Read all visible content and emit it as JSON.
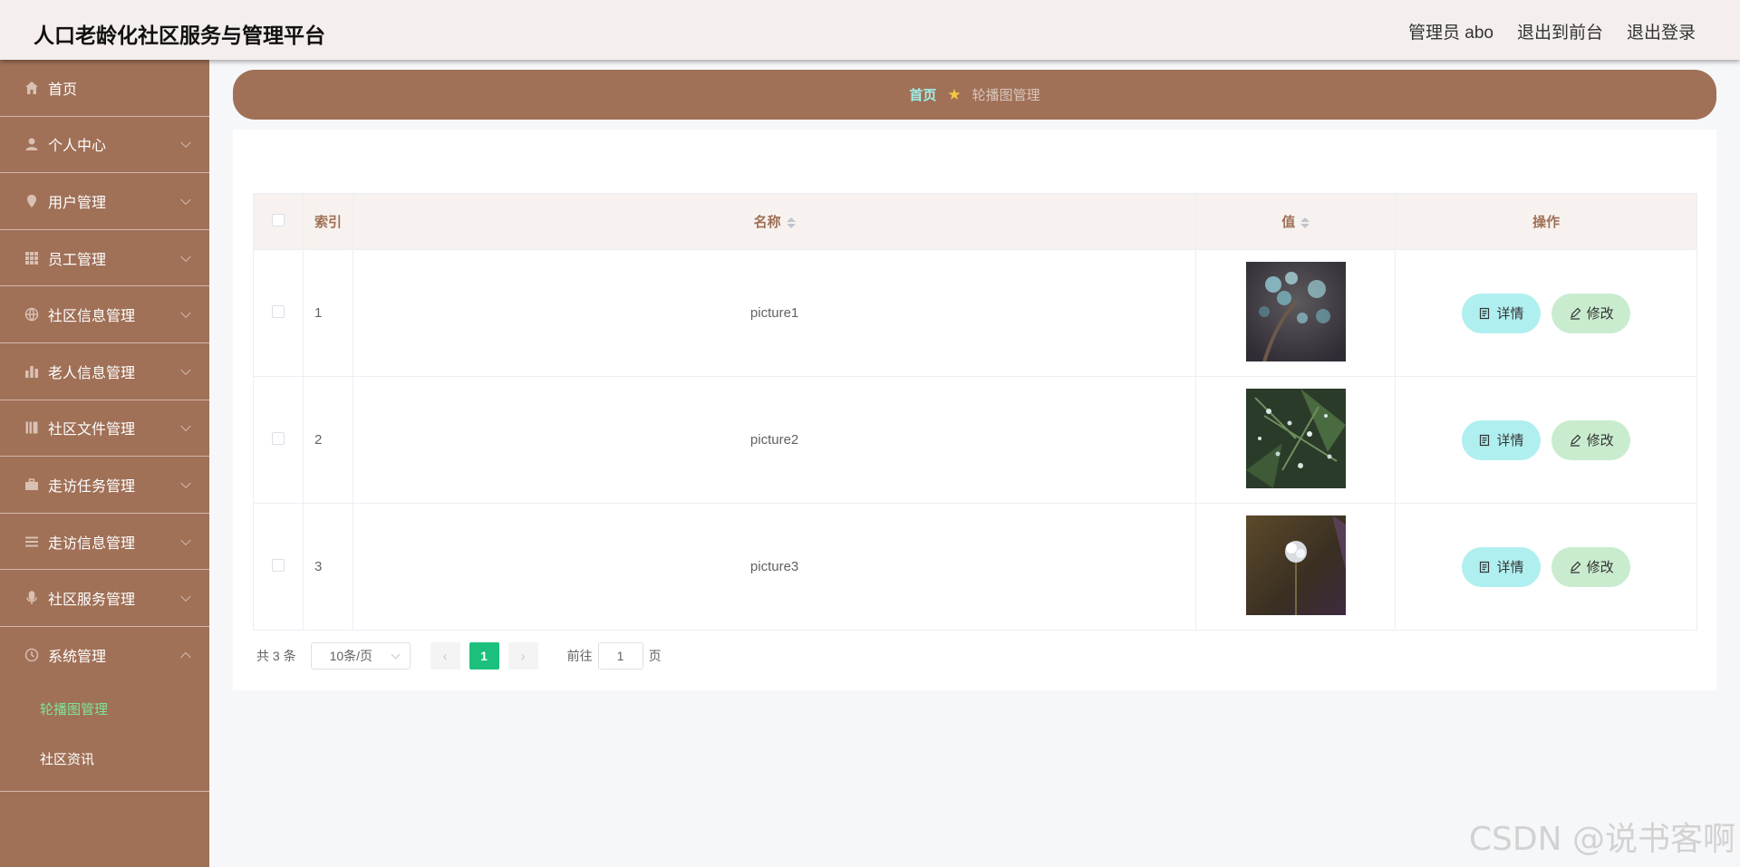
{
  "header": {
    "title": "人口老龄化社区服务与管理平台",
    "admin_label": "管理员 abo",
    "front_label": "退出到前台",
    "logout_label": "退出登录"
  },
  "sidebar": {
    "items": [
      {
        "label": "首页",
        "icon": "home-icon",
        "has_arrow": false
      },
      {
        "label": "个人中心",
        "icon": "user-icon",
        "has_arrow": true
      },
      {
        "label": "用户管理",
        "icon": "location-icon",
        "has_arrow": true
      },
      {
        "label": "员工管理",
        "icon": "grid-icon",
        "has_arrow": true
      },
      {
        "label": "社区信息管理",
        "icon": "globe-icon",
        "has_arrow": true
      },
      {
        "label": "老人信息管理",
        "icon": "bar-chart-icon",
        "has_arrow": true
      },
      {
        "label": "社区文件管理",
        "icon": "folder-icon",
        "has_arrow": true
      },
      {
        "label": "走访任务管理",
        "icon": "briefcase-icon",
        "has_arrow": true
      },
      {
        "label": "走访信息管理",
        "icon": "list-icon",
        "has_arrow": true
      },
      {
        "label": "社区服务管理",
        "icon": "microphone-icon",
        "has_arrow": true
      },
      {
        "label": "系统管理",
        "icon": "clock-icon",
        "has_arrow": true,
        "expanded": true
      }
    ],
    "sub_items": [
      {
        "label": "轮播图管理",
        "active": true
      },
      {
        "label": "社区资讯",
        "active": false
      }
    ]
  },
  "breadcrumb": {
    "home": "首页",
    "current": "轮播图管理"
  },
  "table": {
    "columns": {
      "index": "索引",
      "name": "名称",
      "value": "值",
      "actions": "操作"
    },
    "rows": [
      {
        "index": "1",
        "name": "picture1",
        "image": "blue-flowers-thumbnail"
      },
      {
        "index": "2",
        "name": "picture2",
        "image": "green-foliage-thumbnail"
      },
      {
        "index": "3",
        "name": "picture3",
        "image": "white-flower-thumbnail"
      }
    ],
    "detail_label": "详情",
    "edit_label": "修改"
  },
  "pagination": {
    "total_text": "共 3 条",
    "page_size": "10条/页",
    "current_page": "1",
    "goto_prefix": "前往",
    "goto_value": "1",
    "goto_suffix": "页"
  },
  "watermark": "CSDN @说书客啊",
  "colors": {
    "sidebar_bg": "#a07057",
    "topbar_bg": "#f4eeed",
    "active_sub": "#7fe39a",
    "pager_active": "#1bc07d",
    "detail_btn": "#b0eff0",
    "edit_btn": "#c9eccf"
  }
}
